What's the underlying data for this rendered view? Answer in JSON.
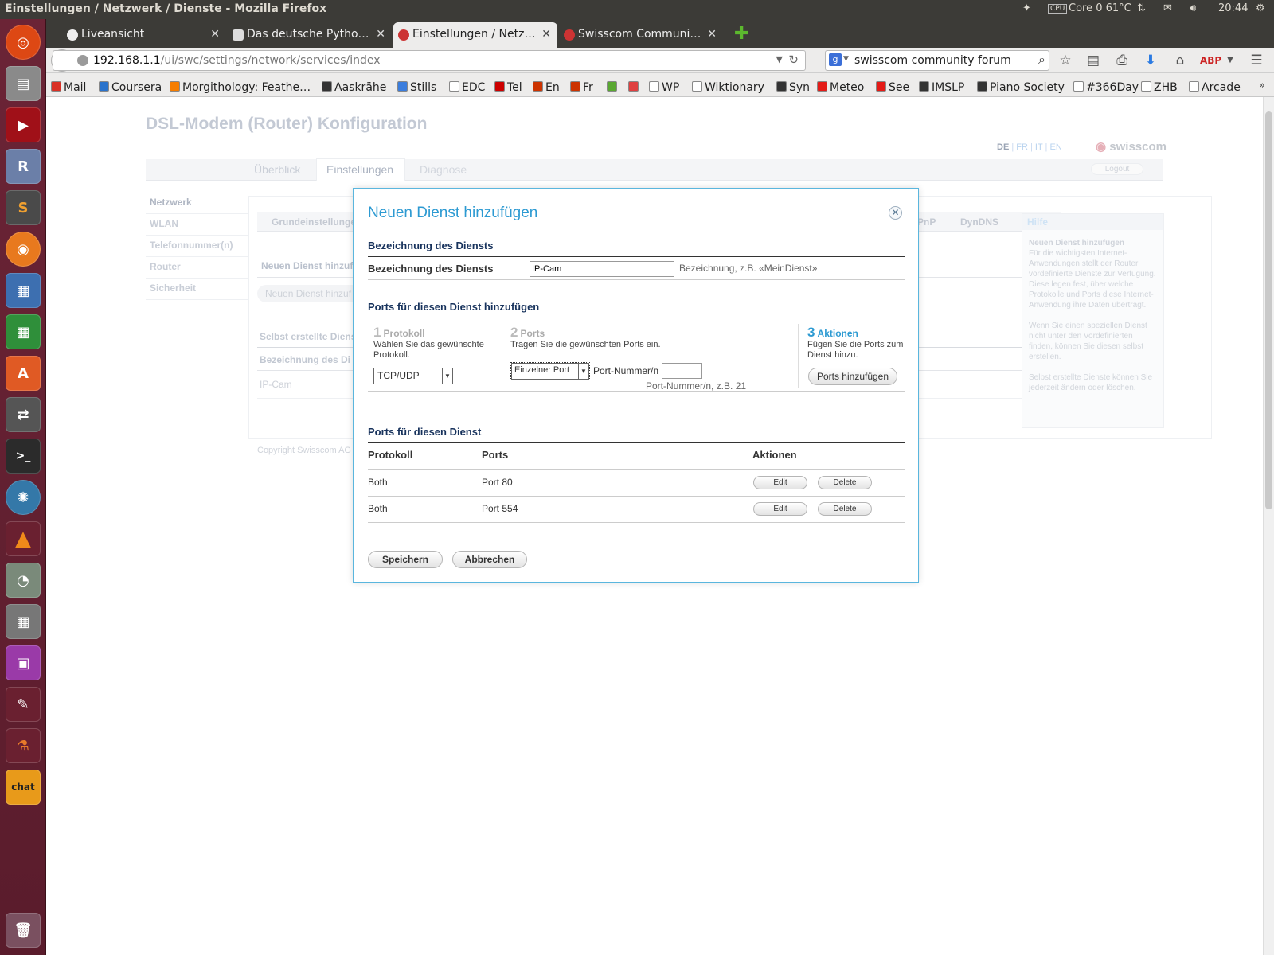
{
  "ubuntu_panel": {
    "window_title": "Einstellungen / Netzwerk / Dienste - Mozilla Firefox",
    "cpu_temp": "Core 0 61°C",
    "clock": "20:44"
  },
  "tabs": [
    {
      "label": "Liveansicht",
      "active": false
    },
    {
      "label": "Das deutsche Pytho…",
      "active": false
    },
    {
      "label": "Einstellungen / Netz…",
      "active": true
    },
    {
      "label": "Swisscom Communi…",
      "active": false
    }
  ],
  "navbar": {
    "url_host": "192.168.1.1",
    "url_path": "/ui/swc/settings/network/services/index",
    "search_value": "swisscom community forum"
  },
  "bookmarks": [
    {
      "label": "Mail",
      "color": "#d93025"
    },
    {
      "label": "Coursera",
      "color": "#2a73cc"
    },
    {
      "label": "Morgithology: Feathe…",
      "color": "#f57d00"
    },
    {
      "label": "Aaskrähe",
      "color": "#333333"
    },
    {
      "label": "Stills",
      "color": "#3b7ddd"
    },
    {
      "label": "EDC",
      "color": "#ffffff"
    },
    {
      "label": "Tel",
      "color": "#cc0000"
    },
    {
      "label": "En",
      "color": "#cc3300"
    },
    {
      "label": "Fr",
      "color": "#cc3300"
    },
    {
      "label": "",
      "color": "#5aa832"
    },
    {
      "label": "",
      "color": "#e04040"
    },
    {
      "label": "WP",
      "color": "#ffffff"
    },
    {
      "label": "Wiktionary",
      "color": "#ffffff"
    },
    {
      "label": "Syn",
      "color": "#333333"
    },
    {
      "label": "Meteo",
      "color": "#e41b17"
    },
    {
      "label": "See",
      "color": "#e41b17"
    },
    {
      "label": "IMSLP",
      "color": "#333333"
    },
    {
      "label": "Piano Society",
      "color": "#333333"
    },
    {
      "label": "#366Day",
      "color": "#ffffff"
    },
    {
      "label": "ZHB",
      "color": "#ffffff"
    },
    {
      "label": "Arcade",
      "color": "#ffffff"
    }
  ],
  "router_page": {
    "header_title": "DSL-Modem (Router) Konfiguration",
    "languages": [
      "DE",
      "FR",
      "IT",
      "EN"
    ],
    "brand": "swisscom",
    "logout": "Logout",
    "main_tabs": [
      "Überblick",
      "Einstellungen",
      "Diagnose"
    ],
    "sidebar": [
      "Netzwerk",
      "WLAN",
      "Telefonnummer(n)",
      "Router",
      "Sicherheit"
    ],
    "subtabs": [
      "Grundeinstellungen",
      "PnP",
      "DynDNS"
    ],
    "section_new": "Neuen Dienst hinzuf",
    "button_new": "Neuen Dienst hinzuf",
    "section_custom": "Selbst erstellte Diens",
    "col_name": "Bezeichnung des Di",
    "row_ipcam": "IP-Cam",
    "copyright": "Copyright Swisscom AG",
    "help": {
      "title": "Hilfe",
      "heading": "Neuen Dienst hinzufügen",
      "p1": "Für die wichtigsten Internet-Anwendungen stellt der Router vordefinierte Dienste zur Verfügung. Diese legen fest, über welche Protokolle und Ports diese Internet-Anwendung ihre Daten überträgt.",
      "p2": "Wenn Sie einen speziellen Dienst nicht unter den Vordefinierten finden, können Sie diesen selbst erstellen.",
      "p3": "Selbst erstellte Dienste können Sie jederzeit ändern oder löschen."
    }
  },
  "modal": {
    "title": "Neuen Dienst hinzufügen",
    "section_name": "Bezeichnung des Diensts",
    "name_label": "Bezeichnung des Diensts",
    "name_value": "IP-Cam",
    "name_hint": "Bezeichnung, z.B. «MeinDienst»",
    "section_ports": "Ports für diesen Dienst hinzufügen",
    "step1": {
      "num": "1",
      "title": "Protokoll",
      "desc": "Wählen Sie das gewünschte Protokoll.",
      "select": "TCP/UDP"
    },
    "step2": {
      "num": "2",
      "title": "Ports",
      "desc": "Tragen Sie die gewünschten Ports ein.",
      "select": "Einzelner Port",
      "port_label": "Port-Nummer/n",
      "port_value": "",
      "port_hint": "Port-Nummer/n, z.B. 21"
    },
    "step3": {
      "num": "3",
      "title": "Aktionen",
      "desc": "Fügen Sie die Ports zum Dienst hinzu.",
      "button": "Ports hinzufügen"
    },
    "section_list": "Ports für diesen Dienst",
    "table_headers": [
      "Protokoll",
      "Ports",
      "Aktionen"
    ],
    "rows": [
      {
        "protocol": "Both",
        "ports": "Port 80",
        "edit": "Edit",
        "delete": "Delete"
      },
      {
        "protocol": "Both",
        "ports": "Port 554",
        "edit": "Edit",
        "delete": "Delete"
      }
    ],
    "save": "Speichern",
    "cancel": "Abbrechen"
  }
}
